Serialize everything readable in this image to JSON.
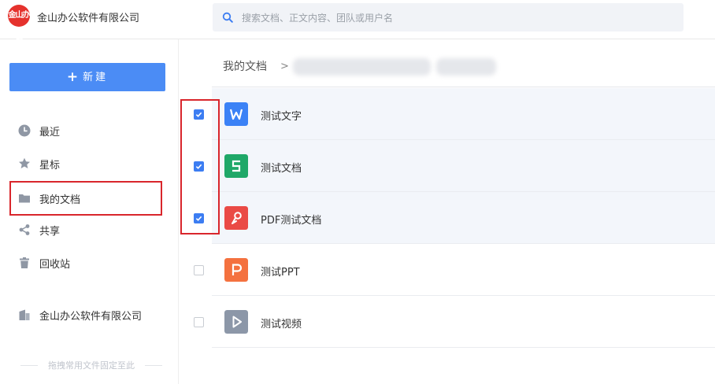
{
  "topbar": {
    "logo_text": "金山办公",
    "company_name": "金山办公软件有限公司",
    "search_placeholder": "搜索文档、正文内容、团队或用户名"
  },
  "sidebar": {
    "new_label": "新建",
    "new_icon": "plus-icon",
    "items": [
      {
        "label": "最近",
        "icon": "clock-icon"
      },
      {
        "label": "星标",
        "icon": "star-icon"
      },
      {
        "label": "我的文档",
        "icon": "folder-icon",
        "selected": true
      },
      {
        "label": "共享",
        "icon": "share-icon"
      },
      {
        "label": "回收站",
        "icon": "trash-icon"
      },
      {
        "label": "金山办公软件有限公司",
        "icon": "building-icon"
      }
    ],
    "pin_hint": "拖拽常用文件固定至此"
  },
  "breadcrumb": {
    "root": "我的文档",
    "separator": ">"
  },
  "files": [
    {
      "name": "测试文字",
      "type": "writer",
      "icon": "writer-doc-icon",
      "checked": true
    },
    {
      "name": "测试文档",
      "type": "spreadsheet",
      "icon": "spreadsheet-doc-icon",
      "checked": true
    },
    {
      "name": "PDF测试文档",
      "type": "pdf",
      "icon": "pdf-doc-icon",
      "checked": true
    },
    {
      "name": "测试PPT",
      "type": "presentation",
      "icon": "presentation-doc-icon",
      "checked": false
    },
    {
      "name": "测试视频",
      "type": "video",
      "icon": "video-file-icon",
      "checked": false
    }
  ],
  "colors": {
    "accent": "#4b8cf5",
    "checkbox_checked": "#3c7df2",
    "highlight_outline": "#d9262c",
    "writer": "#3b82f6",
    "spreadsheet": "#1fa868",
    "pdf": "#ea4a45",
    "presentation": "#f4713f",
    "video": "#8c97a8",
    "logo": "#e5322d"
  }
}
